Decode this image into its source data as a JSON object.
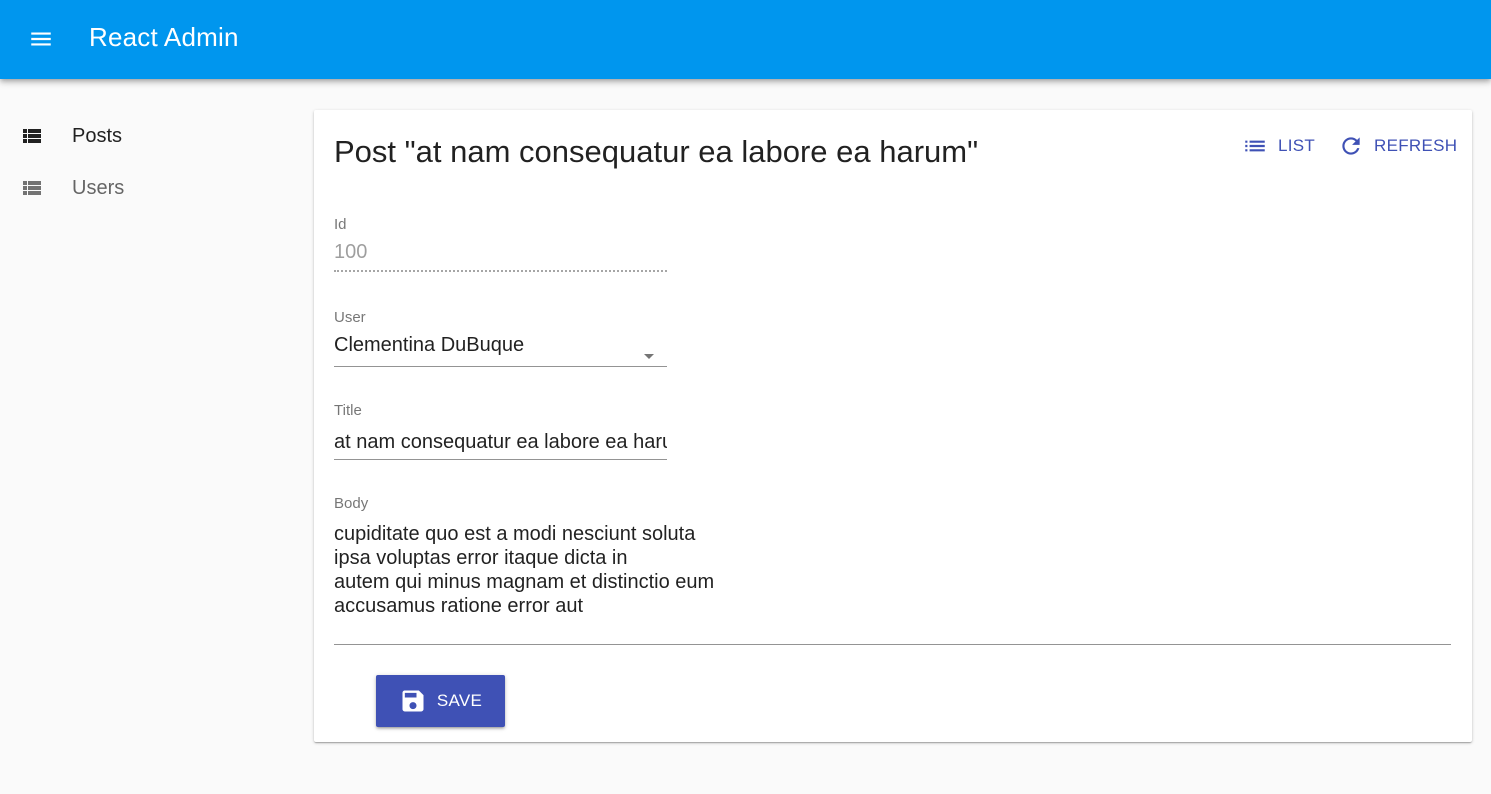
{
  "app": {
    "title": "React Admin",
    "menu_icon": "hamburger-menu-icon"
  },
  "colors": {
    "appbar": "#0096ee",
    "primary": "#3f51b5"
  },
  "sidebar": {
    "items": [
      {
        "label": "Posts",
        "icon": "list-icon",
        "active": true
      },
      {
        "label": "Users",
        "icon": "list-icon",
        "active": false
      }
    ]
  },
  "page": {
    "title": "Post \"at nam consequatur ea labore ea harum\"",
    "actions": {
      "list_label": "LIST",
      "refresh_label": "REFRESH"
    }
  },
  "form": {
    "id": {
      "label": "Id",
      "value": "100"
    },
    "user": {
      "label": "User",
      "value": "Clementina DuBuque"
    },
    "title": {
      "label": "Title",
      "value": "at nam consequatur ea labore ea harum"
    },
    "body": {
      "label": "Body",
      "value": "cupiditate quo est a modi nesciunt soluta\nipsa voluptas error itaque dicta in\nautem qui minus magnam et distinctio eum\naccusamus ratione error aut"
    },
    "save_label": "SAVE"
  }
}
